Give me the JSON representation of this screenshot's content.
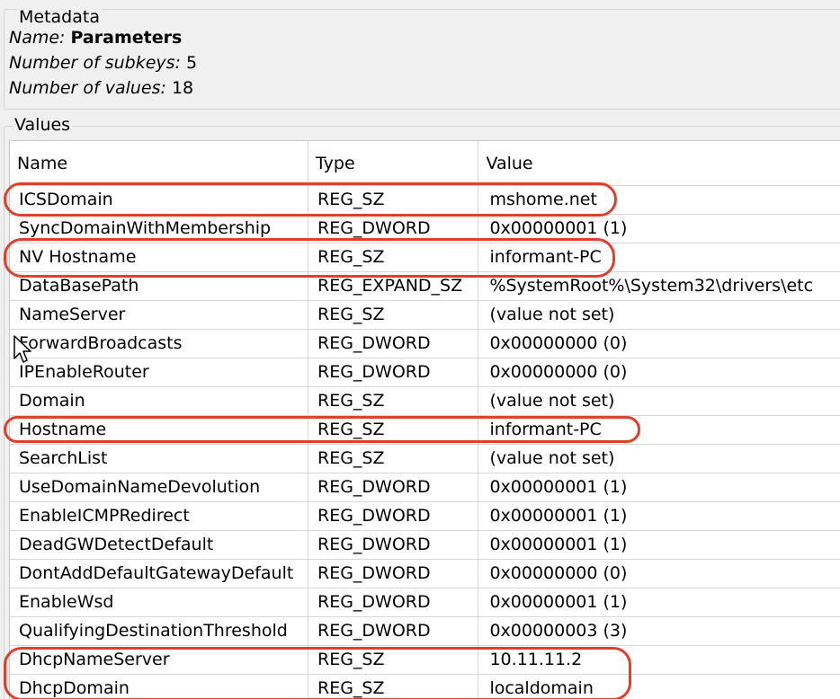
{
  "metadata": {
    "legend": "Metadata",
    "name_label": "Name:",
    "name_value": "Parameters",
    "subkeys_label": "Number of subkeys:",
    "subkeys_value": "5",
    "values_label": "Number of values:",
    "values_value": "18"
  },
  "values": {
    "legend": "Values",
    "columns": [
      "Name",
      "Type",
      "Value"
    ],
    "rows": [
      {
        "name": "ICSDomain",
        "type": "REG_SZ",
        "value": "mshome.net"
      },
      {
        "name": "SyncDomainWithMembership",
        "type": "REG_DWORD",
        "value": "0x00000001 (1)"
      },
      {
        "name": "NV Hostname",
        "type": "REG_SZ",
        "value": "informant-PC"
      },
      {
        "name": "DataBasePath",
        "type": "REG_EXPAND_SZ",
        "value": "%SystemRoot%\\System32\\drivers\\etc"
      },
      {
        "name": "NameServer",
        "type": "REG_SZ",
        "value": "(value not set)"
      },
      {
        "name": "ForwardBroadcasts",
        "type": "REG_DWORD",
        "value": "0x00000000 (0)"
      },
      {
        "name": "IPEnableRouter",
        "type": "REG_DWORD",
        "value": "0x00000000 (0)"
      },
      {
        "name": "Domain",
        "type": "REG_SZ",
        "value": "(value not set)"
      },
      {
        "name": "Hostname",
        "type": "REG_SZ",
        "value": "informant-PC"
      },
      {
        "name": "SearchList",
        "type": "REG_SZ",
        "value": "(value not set)"
      },
      {
        "name": "UseDomainNameDevolution",
        "type": "REG_DWORD",
        "value": "0x00000001 (1)"
      },
      {
        "name": "EnableICMPRedirect",
        "type": "REG_DWORD",
        "value": "0x00000001 (1)"
      },
      {
        "name": "DeadGWDetectDefault",
        "type": "REG_DWORD",
        "value": "0x00000001 (1)"
      },
      {
        "name": "DontAddDefaultGatewayDefault",
        "type": "REG_DWORD",
        "value": "0x00000000 (0)"
      },
      {
        "name": "EnableWsd",
        "type": "REG_DWORD",
        "value": "0x00000001 (1)"
      },
      {
        "name": "QualifyingDestinationThreshold",
        "type": "REG_DWORD",
        "value": "0x00000003 (3)"
      },
      {
        "name": "DhcpNameServer",
        "type": "REG_SZ",
        "value": "10.11.11.2"
      },
      {
        "name": "DhcpDomain",
        "type": "REG_SZ",
        "value": "localdomain"
      }
    ]
  },
  "annotation_color": "#e0402b"
}
